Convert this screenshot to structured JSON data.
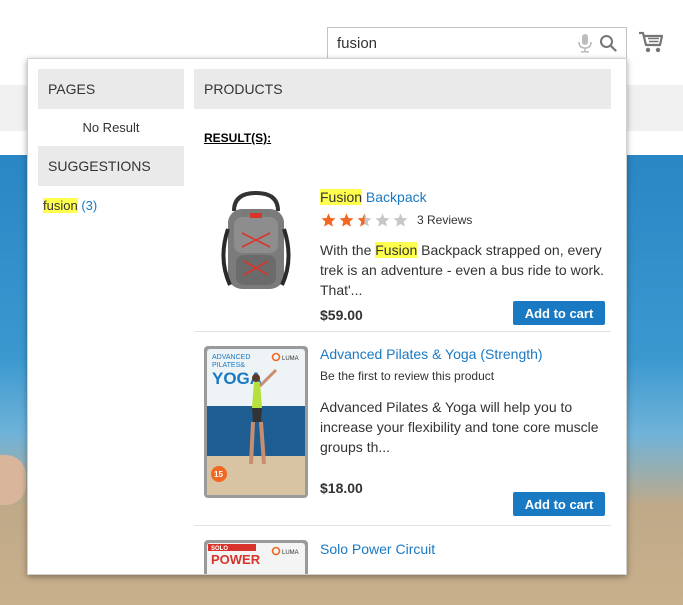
{
  "search": {
    "value": "fusion"
  },
  "popup": {
    "pages": {
      "title": "PAGES",
      "no_result": "No Result"
    },
    "suggestions": {
      "title": "SUGGESTIONS",
      "items": [
        {
          "term": "fusion",
          "count": "(3)"
        }
      ]
    },
    "products": {
      "title": "PRODUCTS",
      "results_label": "RESULT(S):",
      "items": [
        {
          "name_highlight": "Fusion",
          "name_rest": " Backpack",
          "rating_stars": 2.5,
          "reviews": "3 Reviews",
          "desc_before": "With the ",
          "desc_highlight": "Fusion",
          "desc_after": " Backpack strapped on, every trek is an adventure - even a bus ride to work. That'...",
          "price": "$59.00",
          "cart_label": "Add to cart"
        },
        {
          "name": "Advanced Pilates & Yoga (Strength)",
          "review_prompt": "Be the first to review this product",
          "desc": "Advanced Pilates & Yoga will help you to increase your flexibility and tone core muscle groups th...",
          "price": "$18.00",
          "cart_label": "Add to cart",
          "cover": {
            "line1": "ADVANCED",
            "line2": "PILATES&",
            "line3": "YOGA",
            "brand": "LUMA",
            "badge": "15"
          }
        },
        {
          "name": "Solo Power Circuit",
          "cover": {
            "line1": "SOLO",
            "line2": "POWER",
            "brand": "LUMA"
          }
        }
      ]
    }
  },
  "colors": {
    "accent": "#1979c3",
    "highlight": "#ffff4d",
    "star": "#f26722"
  }
}
